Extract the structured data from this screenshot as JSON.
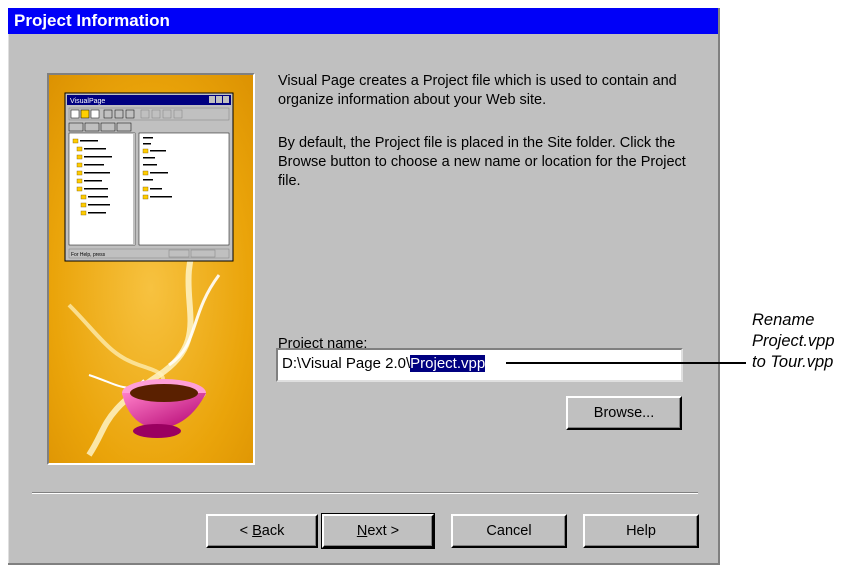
{
  "dialog": {
    "title": "Project Information",
    "description_1": "Visual Page creates a Project file which is used to contain and organize information about your Web site.",
    "description_2": "By default, the Project file is placed in the Site folder. Click the Browse button to choose a new name or location for the Project file.",
    "project_name_label_first": "P",
    "project_name_label_rest": "roject name:",
    "project_name_value_prefix": "D:\\Visual Page 2.0\\",
    "project_name_value_selected": "Project.vpp",
    "browse_label": "Browse...",
    "buttons": {
      "back_prefix": "< ",
      "back_mnemonic": "B",
      "back_rest": "ack",
      "next_mnemonic": "N",
      "next_rest": "ext >",
      "cancel": "Cancel",
      "help": "Help"
    }
  },
  "annotation": {
    "line1": "Rename",
    "line2": "Project.vpp",
    "line3": "to Tour.vpp"
  },
  "illustration": {
    "app_title": "VisualPage",
    "status_text": "For Help, press"
  },
  "colors": {
    "titlebar": "#0000f8",
    "dialog_face": "#c0c0c0",
    "selection": "#000080",
    "illustration_bg": "#e8a800"
  }
}
